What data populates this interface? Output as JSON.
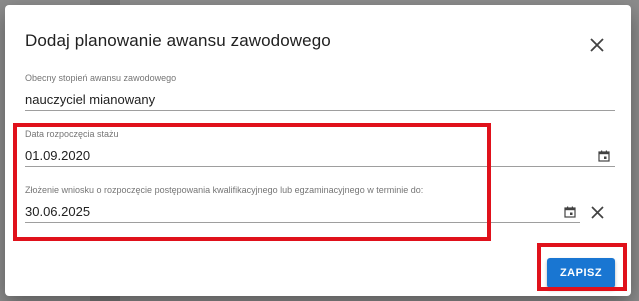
{
  "dialog": {
    "title": "Dodaj planowanie awansu zawodowego",
    "close_icon": "close-icon"
  },
  "fields": {
    "current_degree": {
      "label": "Obecny stopień awansu zawodowego",
      "value": "nauczyciel mianowany"
    },
    "internship_start": {
      "label": "Data rozpoczęcia stażu",
      "value": "01.09.2020",
      "icon": "calendar-icon"
    },
    "application_date": {
      "label": "Złożenie wniosku o rozpoczęcie postępowania kwalifikacyjnego lub egzaminacyjnego w terminie do:",
      "value": "30.06.2025",
      "icon": "calendar-icon",
      "clear_icon": "clear-icon"
    }
  },
  "actions": {
    "save_label": "ZAPISZ"
  },
  "colors": {
    "primary": "#1976d2",
    "highlight": "#e0111b"
  }
}
